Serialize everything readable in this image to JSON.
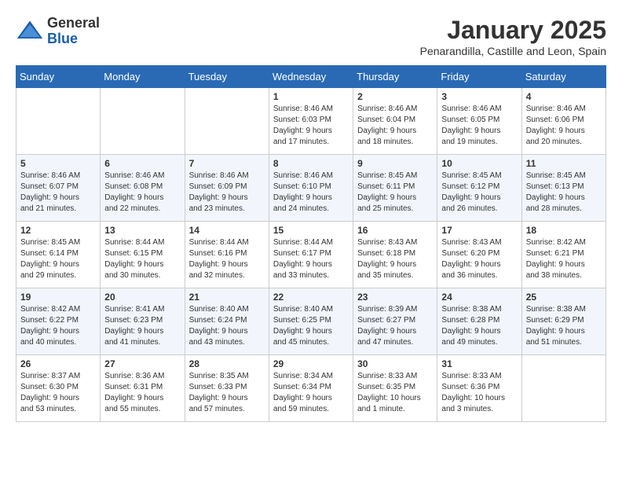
{
  "header": {
    "logo_general": "General",
    "logo_blue": "Blue",
    "month_title": "January 2025",
    "subtitle": "Penarandilla, Castille and Leon, Spain"
  },
  "days_of_week": [
    "Sunday",
    "Monday",
    "Tuesday",
    "Wednesday",
    "Thursday",
    "Friday",
    "Saturday"
  ],
  "weeks": [
    [
      {
        "day": "",
        "info": ""
      },
      {
        "day": "",
        "info": ""
      },
      {
        "day": "",
        "info": ""
      },
      {
        "day": "1",
        "info": "Sunrise: 8:46 AM\nSunset: 6:03 PM\nDaylight: 9 hours\nand 17 minutes."
      },
      {
        "day": "2",
        "info": "Sunrise: 8:46 AM\nSunset: 6:04 PM\nDaylight: 9 hours\nand 18 minutes."
      },
      {
        "day": "3",
        "info": "Sunrise: 8:46 AM\nSunset: 6:05 PM\nDaylight: 9 hours\nand 19 minutes."
      },
      {
        "day": "4",
        "info": "Sunrise: 8:46 AM\nSunset: 6:06 PM\nDaylight: 9 hours\nand 20 minutes."
      }
    ],
    [
      {
        "day": "5",
        "info": "Sunrise: 8:46 AM\nSunset: 6:07 PM\nDaylight: 9 hours\nand 21 minutes."
      },
      {
        "day": "6",
        "info": "Sunrise: 8:46 AM\nSunset: 6:08 PM\nDaylight: 9 hours\nand 22 minutes."
      },
      {
        "day": "7",
        "info": "Sunrise: 8:46 AM\nSunset: 6:09 PM\nDaylight: 9 hours\nand 23 minutes."
      },
      {
        "day": "8",
        "info": "Sunrise: 8:46 AM\nSunset: 6:10 PM\nDaylight: 9 hours\nand 24 minutes."
      },
      {
        "day": "9",
        "info": "Sunrise: 8:45 AM\nSunset: 6:11 PM\nDaylight: 9 hours\nand 25 minutes."
      },
      {
        "day": "10",
        "info": "Sunrise: 8:45 AM\nSunset: 6:12 PM\nDaylight: 9 hours\nand 26 minutes."
      },
      {
        "day": "11",
        "info": "Sunrise: 8:45 AM\nSunset: 6:13 PM\nDaylight: 9 hours\nand 28 minutes."
      }
    ],
    [
      {
        "day": "12",
        "info": "Sunrise: 8:45 AM\nSunset: 6:14 PM\nDaylight: 9 hours\nand 29 minutes."
      },
      {
        "day": "13",
        "info": "Sunrise: 8:44 AM\nSunset: 6:15 PM\nDaylight: 9 hours\nand 30 minutes."
      },
      {
        "day": "14",
        "info": "Sunrise: 8:44 AM\nSunset: 6:16 PM\nDaylight: 9 hours\nand 32 minutes."
      },
      {
        "day": "15",
        "info": "Sunrise: 8:44 AM\nSunset: 6:17 PM\nDaylight: 9 hours\nand 33 minutes."
      },
      {
        "day": "16",
        "info": "Sunrise: 8:43 AM\nSunset: 6:18 PM\nDaylight: 9 hours\nand 35 minutes."
      },
      {
        "day": "17",
        "info": "Sunrise: 8:43 AM\nSunset: 6:20 PM\nDaylight: 9 hours\nand 36 minutes."
      },
      {
        "day": "18",
        "info": "Sunrise: 8:42 AM\nSunset: 6:21 PM\nDaylight: 9 hours\nand 38 minutes."
      }
    ],
    [
      {
        "day": "19",
        "info": "Sunrise: 8:42 AM\nSunset: 6:22 PM\nDaylight: 9 hours\nand 40 minutes."
      },
      {
        "day": "20",
        "info": "Sunrise: 8:41 AM\nSunset: 6:23 PM\nDaylight: 9 hours\nand 41 minutes."
      },
      {
        "day": "21",
        "info": "Sunrise: 8:40 AM\nSunset: 6:24 PM\nDaylight: 9 hours\nand 43 minutes."
      },
      {
        "day": "22",
        "info": "Sunrise: 8:40 AM\nSunset: 6:25 PM\nDaylight: 9 hours\nand 45 minutes."
      },
      {
        "day": "23",
        "info": "Sunrise: 8:39 AM\nSunset: 6:27 PM\nDaylight: 9 hours\nand 47 minutes."
      },
      {
        "day": "24",
        "info": "Sunrise: 8:38 AM\nSunset: 6:28 PM\nDaylight: 9 hours\nand 49 minutes."
      },
      {
        "day": "25",
        "info": "Sunrise: 8:38 AM\nSunset: 6:29 PM\nDaylight: 9 hours\nand 51 minutes."
      }
    ],
    [
      {
        "day": "26",
        "info": "Sunrise: 8:37 AM\nSunset: 6:30 PM\nDaylight: 9 hours\nand 53 minutes."
      },
      {
        "day": "27",
        "info": "Sunrise: 8:36 AM\nSunset: 6:31 PM\nDaylight: 9 hours\nand 55 minutes."
      },
      {
        "day": "28",
        "info": "Sunrise: 8:35 AM\nSunset: 6:33 PM\nDaylight: 9 hours\nand 57 minutes."
      },
      {
        "day": "29",
        "info": "Sunrise: 8:34 AM\nSunset: 6:34 PM\nDaylight: 9 hours\nand 59 minutes."
      },
      {
        "day": "30",
        "info": "Sunrise: 8:33 AM\nSunset: 6:35 PM\nDaylight: 10 hours\nand 1 minute."
      },
      {
        "day": "31",
        "info": "Sunrise: 8:33 AM\nSunset: 6:36 PM\nDaylight: 10 hours\nand 3 minutes."
      },
      {
        "day": "",
        "info": ""
      }
    ]
  ]
}
